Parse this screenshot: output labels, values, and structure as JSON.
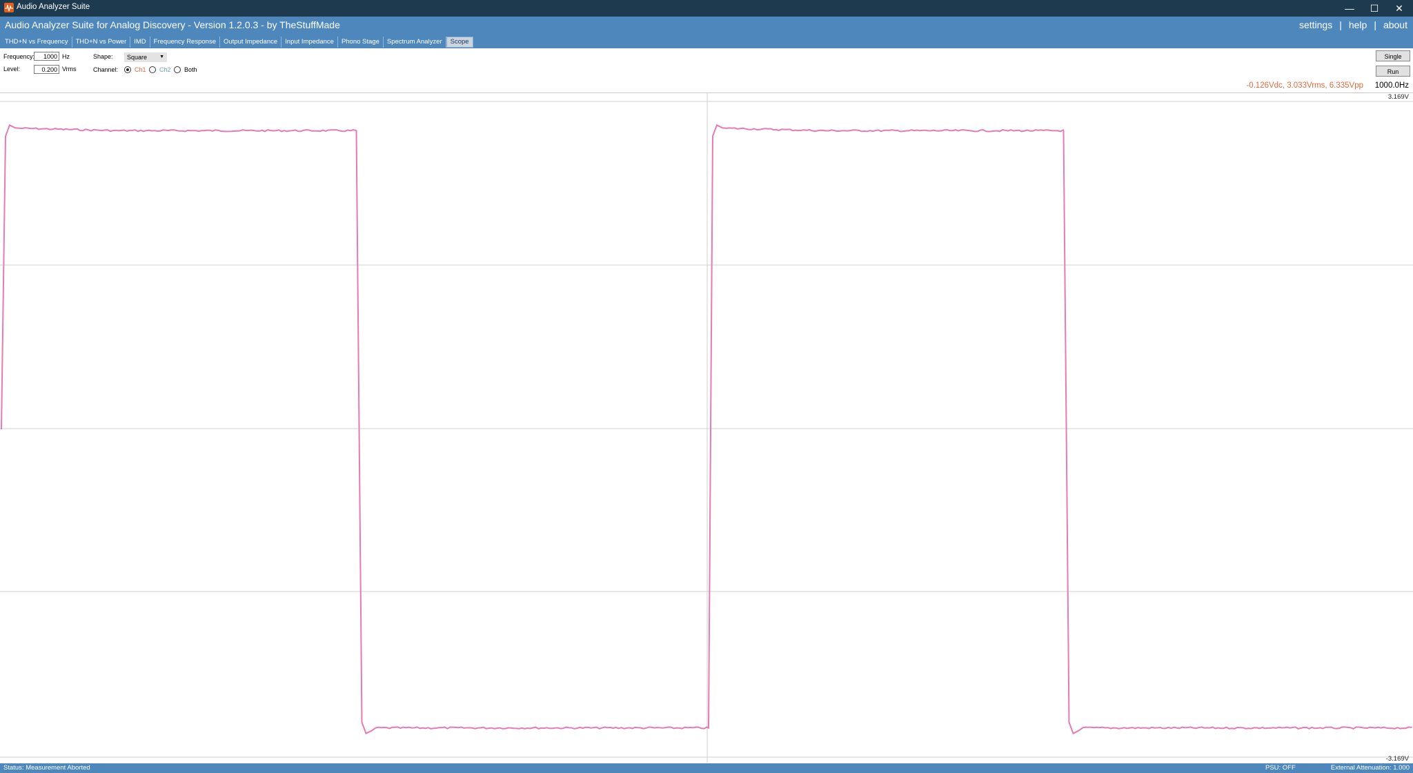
{
  "window": {
    "title": "Audio Analyzer Suite",
    "buttons": {
      "minimize": "—",
      "maximize": "☐",
      "close": "✕"
    }
  },
  "header": {
    "title": "Audio Analyzer Suite for Analog Discovery - Version   1.2.0.3   - by TheStuffMade",
    "nav": {
      "settings": "settings",
      "help": "help",
      "about": "about",
      "sep": "|"
    }
  },
  "tabs": [
    {
      "label": "THD+N vs Frequency"
    },
    {
      "label": "THD+N vs Power"
    },
    {
      "label": "IMD"
    },
    {
      "label": "Frequency Response"
    },
    {
      "label": "Output Impedance"
    },
    {
      "label": "Input Impedance"
    },
    {
      "label": "Phono Stage"
    },
    {
      "label": "Spectrum Analyzer"
    },
    {
      "label": "Scope",
      "active": true
    }
  ],
  "controls": {
    "frequency_label": "Frequency:",
    "frequency_value": "1000",
    "frequency_unit": "Hz",
    "level_label": "Level:",
    "level_value": "0.200",
    "level_unit": "Vrms",
    "shape_label": "Shape:",
    "shape_value": "Square",
    "channel_label": "Channel:",
    "channels": [
      {
        "label": "Ch1",
        "selected": true,
        "color": "#e06a3b"
      },
      {
        "label": "Ch2",
        "selected": false,
        "color": "#6aa0d0"
      },
      {
        "label": "Both",
        "selected": false,
        "color": "#000000"
      }
    ],
    "single_button": "Single",
    "run_button": "Run"
  },
  "readout": {
    "measurement": "-0.126Vdc, 3.033Vrms, 6.335Vpp",
    "measurement_color": "#e06a3b",
    "frequency": "1000.0Hz"
  },
  "chart_data": {
    "type": "line",
    "title": "",
    "xlabel": "",
    "ylabel": "",
    "ylim": [
      -3.169,
      3.169
    ],
    "ymax_label": "3.169V",
    "ymin_label": "-3.169V",
    "grid": true,
    "series": [
      {
        "color": "#e57ab4",
        "shape": "square",
        "periods_shown": 2,
        "high_v": 2.9,
        "low_v": -2.9
      }
    ]
  },
  "status": {
    "text": "Status: Measurement Aborted",
    "psu": "PSU: OFF",
    "attenuation": "External Attenuation: 1.000"
  },
  "colors": {
    "titlebar": "#1e3a4f",
    "header": "#4d87bc",
    "trace": "#e57ab4"
  }
}
